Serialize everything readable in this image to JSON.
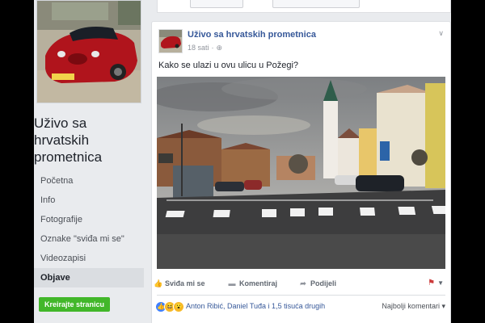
{
  "page": {
    "name": "Uživo sa hrvatskih prometnica",
    "create_button": "Kreirajte stranicu"
  },
  "nav": {
    "items": [
      {
        "label": "Početna"
      },
      {
        "label": "Info"
      },
      {
        "label": "Fotografije"
      },
      {
        "label": "Oznake \"sviđa mi se\""
      },
      {
        "label": "Videozapisi"
      },
      {
        "label": "Objave"
      }
    ]
  },
  "post": {
    "author": "Uživo sa hrvatskih prometnica",
    "time": "18 sati",
    "privacy_icon": "globe-icon",
    "text": "Kako se ulazi u ovu ulicu u Požegi?",
    "actions": {
      "like": "Sviđa mi se",
      "comment": "Komentiraj",
      "share": "Podijeli"
    },
    "reactions": {
      "icons": [
        "like-icon",
        "haha-icon",
        "wow-icon"
      ],
      "names": "Anton Ribić, Daniel Tuđa i 1,5 tisuća drugih"
    },
    "comments_sort": "Najbolji komentari"
  },
  "colors": {
    "link": "#365899",
    "brand_green": "#42b72a",
    "background": "#e9ebee"
  }
}
